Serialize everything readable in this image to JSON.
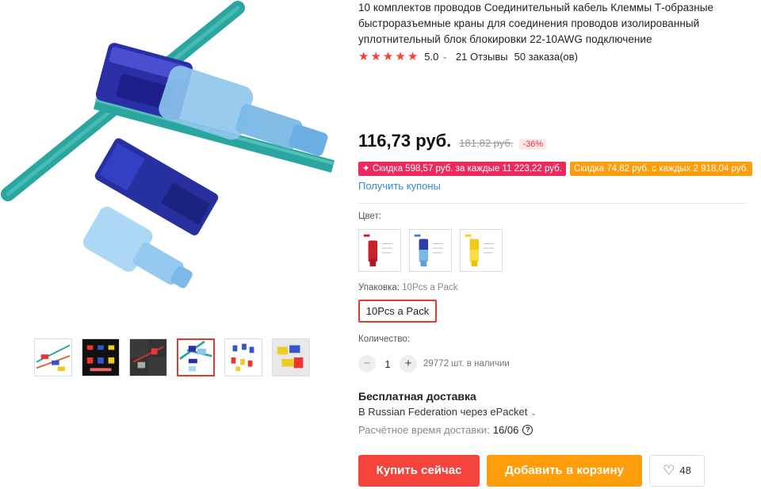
{
  "product": {
    "title": "10 комплектов проводов Соединительный кабель Клеммы Т-образные быстроразъемные краны для соединения проводов изолированный уплотнительный блок блокировки 22-10AWG подключение",
    "rating": "5.0",
    "stars": 5,
    "reviews": "21 Отзывы",
    "orders": "50 заказа(ов)"
  },
  "price": {
    "current": "116,73 руб.",
    "old": "181,82 руб.",
    "discount": "-36%"
  },
  "promos": [
    {
      "text": "✦ Скидка 598,57 руб. за каждые 11 223,22 руб.",
      "color": "#ec2a5f"
    },
    {
      "text": "Скидка 74,82 руб. с каждых 2 918,04 руб.",
      "color": "#ff9d0a"
    }
  ],
  "coupons_link": "Получить купоны",
  "color": {
    "label": "Цвет:",
    "options": [
      {
        "icon": "red-connector-swatch",
        "color": "#c8232c"
      },
      {
        "icon": "blue-connector-swatch",
        "color": "#3a7fd0"
      },
      {
        "icon": "yellow-connector-swatch",
        "color": "#f2d21c"
      }
    ]
  },
  "pack": {
    "label": "Упаковка:",
    "selected": "10Pcs a Pack",
    "option": "10Pcs a Pack"
  },
  "quantity": {
    "label": "Количество:",
    "minus": "−",
    "value": "1",
    "plus": "+",
    "stock": "29772 шт. в наличии"
  },
  "shipping": {
    "title": "Бесплатная доставка",
    "destination": "В Russian Federation через ePacket",
    "time_label": "Расчётное время доставки:",
    "time_value": "16/06",
    "help": "?"
  },
  "buttons": {
    "buy": "Купить сейчас",
    "cart": "Добавить в корзину",
    "wishlist_count": "48"
  },
  "gallery": {
    "thumbnails": [
      "thumb-1",
      "thumb-2",
      "thumb-3",
      "thumb-4",
      "thumb-5",
      "thumb-6"
    ],
    "active_index": 3
  },
  "colors": {
    "accent": "#f5443c",
    "orange": "#ff9d0a",
    "link": "#2e8bd6",
    "star": "#f44336"
  }
}
